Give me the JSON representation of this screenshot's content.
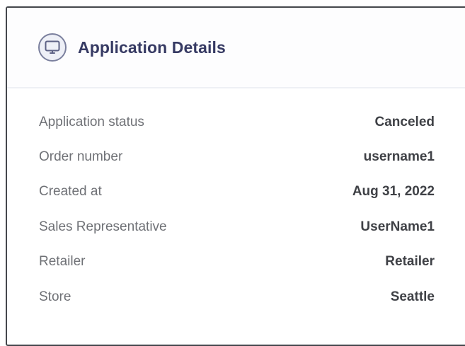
{
  "header": {
    "title": "Application Details",
    "icon": "monitor-icon"
  },
  "details": [
    {
      "label": "Application status",
      "value": "Canceled"
    },
    {
      "label": "Order number",
      "value": "username1"
    },
    {
      "label": "Created at",
      "value": "Aug 31, 2022"
    },
    {
      "label": "Sales Representative",
      "value": "UserName1"
    },
    {
      "label": "Retailer",
      "value": "Retailer"
    },
    {
      "label": "Store",
      "value": "Seattle"
    }
  ],
  "colors": {
    "title": "#363a63",
    "label": "#6f7176",
    "value": "#3f4146",
    "icon_border": "#7b809e"
  }
}
